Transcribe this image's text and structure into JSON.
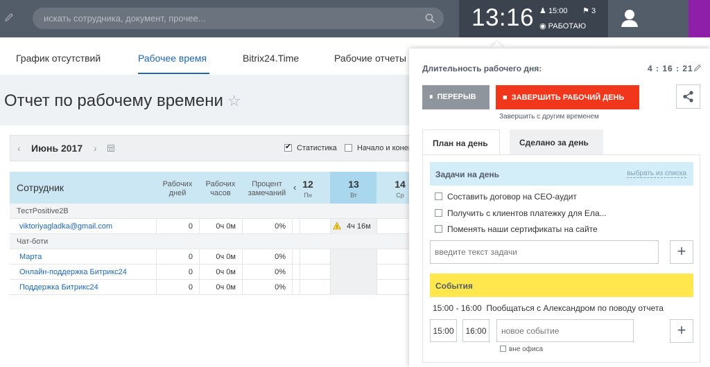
{
  "header": {
    "search_placeholder": "искать сотрудника, документ, прочее...",
    "clock": "13:16",
    "alarm_time": "15:00",
    "flag_count": "3",
    "status": "РАБОТАЮ",
    "accent_color": "#8e1fa8"
  },
  "nav": {
    "tabs": [
      "График отсутствий",
      "Рабочее время",
      "Bitrix24.Time",
      "Рабочие отчеты"
    ],
    "active_tab": "Рабочее время"
  },
  "page": {
    "title": "Отчет по рабочему времени",
    "month": "Июнь 2017",
    "checkbox_stats": "Статистика",
    "checkbox_start": "Начало и конец"
  },
  "table": {
    "col_employee": "Сотрудник",
    "col_days": "Рабочих дней",
    "col_hours": "Рабочих часов",
    "col_percent": "Процент замечаний",
    "days": [
      {
        "num": "12",
        "dow": "Пн"
      },
      {
        "num": "13",
        "dow": "Вт"
      },
      {
        "num": "14",
        "dow": "Ср"
      }
    ],
    "group1": "ТестPositive2B",
    "group2": "Чат-боти",
    "rows": [
      {
        "name": "viktoriyagladka@gmail.com",
        "days": "0",
        "hours": "0ч 0м",
        "percent": "0%",
        "today": "4ч 16м"
      },
      {
        "name": "Марта",
        "days": "0",
        "hours": "0ч 0м",
        "percent": "0%",
        "today": ""
      },
      {
        "name": "Онлайн-поддержка Битрикс24",
        "days": "0",
        "hours": "0ч 0м",
        "percent": "0%",
        "today": ""
      },
      {
        "name": "Поддержка Битрикс24",
        "days": "0",
        "hours": "0ч 0м",
        "percent": "0%",
        "today": ""
      }
    ]
  },
  "popup": {
    "duration_label": "Длительность рабочего дня:",
    "duration_value": "4 : 16 : 21",
    "pause_button": "ПЕРЕРЫВ",
    "finish_button": "ЗАВЕРШИТЬ РАБОЧИЙ ДЕНЬ",
    "finish_other": "Завершить с другим временем",
    "tab_plan": "План на день",
    "tab_done": "Сделано за день",
    "tasks_header": "Задачи на день",
    "tasks_pick": "выбрать из списка",
    "tasks": [
      "Составить договор на СЕО-аудит",
      "Получить с клиентов платежку для Ела...",
      "Поменять наши сертификаты на сайте"
    ],
    "task_input_placeholder": "введите текст задачи",
    "events_header": "События",
    "event_time": "15:00 - 16:00",
    "event_text": "Пообщаться с Александром по поводу отчета",
    "event_from": "15:00",
    "event_to": "16:00",
    "event_input_placeholder": "новое событие",
    "out_of_office": "вне офиса",
    "finish_color": "#f0371b",
    "events_color": "#ffe74d",
    "tasks_color": "#d3edf9"
  }
}
